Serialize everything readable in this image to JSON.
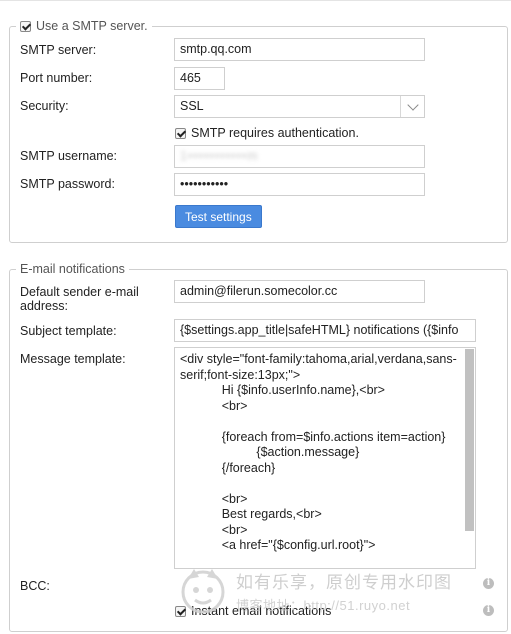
{
  "smtp": {
    "legend": "Use a SMTP server.",
    "use_smtp_checked": true,
    "server_label": "SMTP server:",
    "server_value": "smtp.qq.com",
    "port_label": "Port number:",
    "port_value": "465",
    "security_label": "Security:",
    "security_value": "SSL",
    "auth_label": "SMTP requires authentication.",
    "auth_checked": true,
    "username_label": "SMTP username:",
    "username_value": "1•••••••••••m",
    "password_label": "SMTP password:",
    "password_value": "•••••••••••",
    "test_button": "Test settings"
  },
  "email": {
    "legend": "E-mail notifications",
    "sender_label": "Default sender e-mail address:",
    "sender_value": "admin@filerun.somecolor.cc",
    "subject_label": "Subject template:",
    "subject_value": "{$settings.app_title|safeHTML} notifications ({$info",
    "message_label": "Message template:",
    "message_value": "<div style=\"font-family:tahoma,arial,verdana,sans-serif;font-size:13px;\">\n            Hi {$info.userInfo.name},<br>\n            <br>\n\n            {foreach from=$info.actions item=action}\n                      {$action.message}\n            {/foreach}\n\n            <br>\n            Best regards,<br>\n            <br>\n            <a href=\"{$config.url.root}\">",
    "bcc_label": "BCC:",
    "instant_label": "Instant email notifications",
    "instant_checked": true
  },
  "watermark": {
    "line1": "如有乐享，原创专用水印图",
    "line2": "博客地址：http://51.ruyo.net"
  },
  "icons": {
    "info": "info-icon",
    "dropdown": "chevron-down-icon",
    "checkbox": "checkbox-icon"
  }
}
